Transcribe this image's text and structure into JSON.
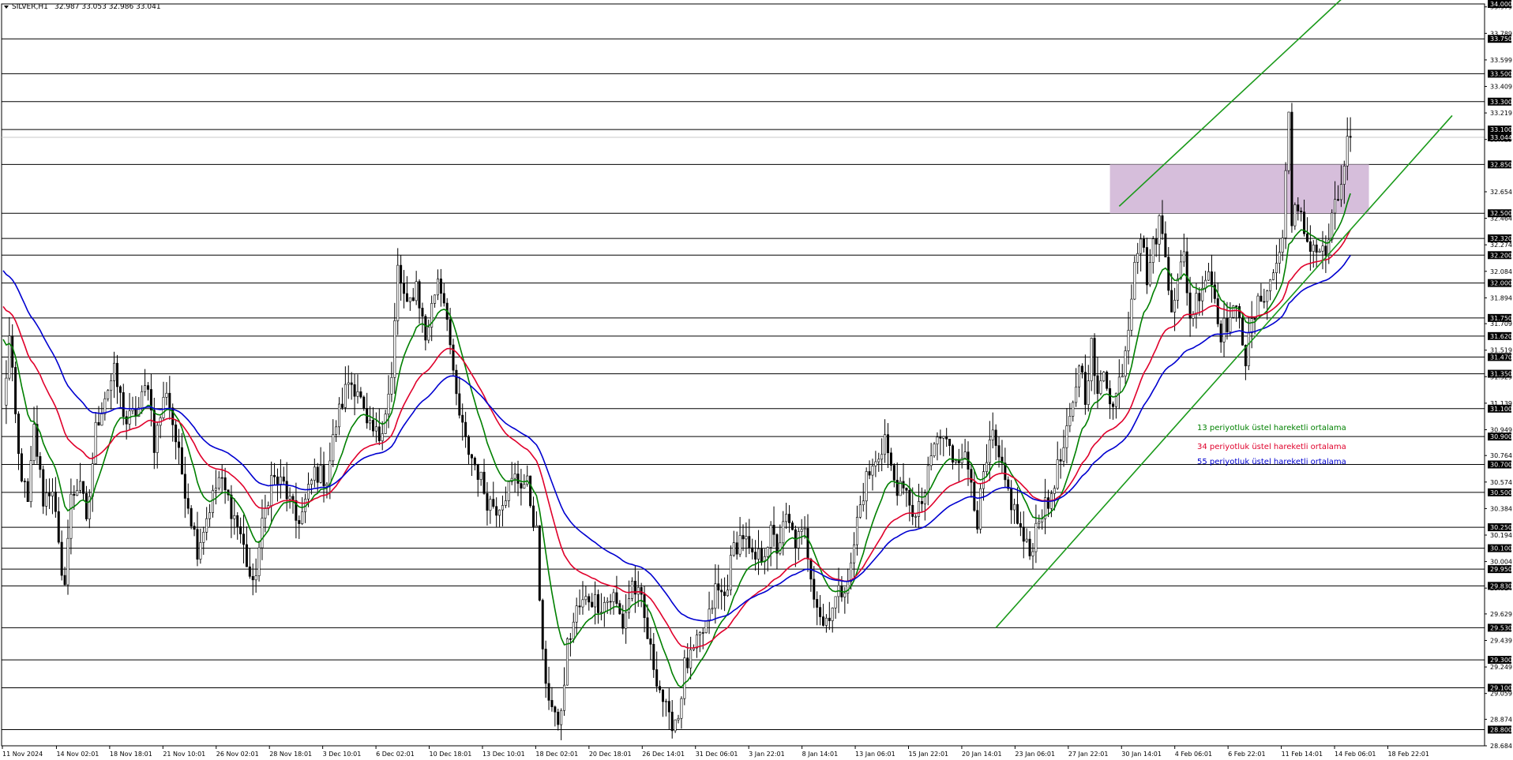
{
  "header": {
    "symbol": "SILVER,H1",
    "ohlc": "32.987 33.053 32.986 33.041"
  },
  "colors": {
    "background": "#ffffff",
    "candle": "#000000",
    "ema13": "#008000",
    "ema34": "#e0002b",
    "ema55": "#0000d0",
    "channel": "#1a9a1a",
    "zone": "#d6bedb",
    "hline": "#000000"
  },
  "chart_data": {
    "type": "candlestick",
    "title": "SILVER,H1",
    "ylim": [
      28.684,
      34.0
    ],
    "grid": false,
    "y_ticks": [
      "33.979",
      "33.789",
      "33.599",
      "33.409",
      "33.219",
      "33.029",
      "32.654",
      "32.464",
      "32.274",
      "32.084",
      "31.894",
      "31.709",
      "31.519",
      "31.329",
      "31.139",
      "30.949",
      "30.764",
      "30.574",
      "30.384",
      "30.194",
      "30.004",
      "29.814",
      "29.629",
      "29.439",
      "29.249",
      "29.059",
      "28.874",
      "28.684"
    ],
    "horizontal_levels": [
      "34.000",
      "33.750",
      "33.500",
      "33.300",
      "33.100",
      "32.850",
      "32.500",
      "32.320",
      "32.200",
      "32.000",
      "31.750",
      "31.620",
      "31.470",
      "31.350",
      "31.100",
      "30.900",
      "30.700",
      "30.500",
      "30.250",
      "30.100",
      "29.950",
      "29.830",
      "29.530",
      "29.300",
      "29.100",
      "28.800"
    ],
    "current_price": "33.044",
    "x_labels": [
      "11 Nov 2024",
      "14 Nov 02:01",
      "18 Nov 18:01",
      "21 Nov 10:01",
      "26 Nov 02:01",
      "28 Nov 18:01",
      "3 Dec 10:01",
      "6 Dec 02:01",
      "10 Dec 18:01",
      "13 Dec 10:01",
      "18 Dec 02:01",
      "20 Dec 18:01",
      "26 Dec 14:01",
      "31 Dec 06:01",
      "3 Jan 22:01",
      "8 Jan 14:01",
      "13 Jan 06:01",
      "15 Jan 22:01",
      "20 Jan 14:01",
      "23 Jan 06:01",
      "27 Jan 22:01",
      "30 Jan 14:01",
      "4 Feb 06:01",
      "6 Feb 22:01",
      "11 Feb 14:01",
      "14 Feb 06:01",
      "18 Feb 22:01"
    ],
    "price_path": [
      [
        0,
        31.1
      ],
      [
        2,
        31.6
      ],
      [
        5,
        30.75
      ],
      [
        8,
        30.4
      ],
      [
        10,
        30.95
      ],
      [
        13,
        30.45
      ],
      [
        16,
        30.55
      ],
      [
        19,
        29.85
      ],
      [
        20,
        29.9
      ],
      [
        22,
        30.45
      ],
      [
        25,
        30.6
      ],
      [
        27,
        30.25
      ],
      [
        30,
        30.95
      ],
      [
        33,
        31.2
      ],
      [
        36,
        31.35
      ],
      [
        40,
        31.0
      ],
      [
        44,
        31.1
      ],
      [
        47,
        31.3
      ],
      [
        49,
        30.85
      ],
      [
        53,
        31.25
      ],
      [
        57,
        30.75
      ],
      [
        63,
        30.1
      ],
      [
        67,
        30.4
      ],
      [
        70,
        30.6
      ],
      [
        73,
        30.45
      ],
      [
        77,
        30.2
      ],
      [
        81,
        29.8
      ],
      [
        84,
        30.25
      ],
      [
        87,
        30.6
      ],
      [
        91,
        30.55
      ],
      [
        95,
        30.3
      ],
      [
        97,
        30.35
      ],
      [
        101,
        30.65
      ],
      [
        105,
        30.6
      ],
      [
        108,
        31.0
      ],
      [
        112,
        31.3
      ],
      [
        115,
        31.25
      ],
      [
        118,
        30.95
      ],
      [
        122,
        30.9
      ],
      [
        126,
        31.3
      ],
      [
        128,
        32.1
      ],
      [
        131,
        31.8
      ],
      [
        134,
        32.0
      ],
      [
        137,
        31.6
      ],
      [
        141,
        32.05
      ],
      [
        144,
        31.8
      ],
      [
        146,
        31.3
      ],
      [
        148,
        31.05
      ],
      [
        150,
        30.85
      ],
      [
        154,
        30.65
      ],
      [
        157,
        30.45
      ],
      [
        160,
        30.4
      ],
      [
        163,
        30.5
      ],
      [
        166,
        30.6
      ],
      [
        170,
        30.55
      ],
      [
        173,
        30.2
      ],
      [
        175,
        29.3
      ],
      [
        177,
        29.05
      ],
      [
        179,
        28.85
      ],
      [
        181,
        28.9
      ],
      [
        183,
        29.4
      ],
      [
        186,
        29.65
      ],
      [
        190,
        29.75
      ],
      [
        194,
        29.7
      ],
      [
        198,
        29.75
      ],
      [
        201,
        29.55
      ],
      [
        204,
        29.85
      ],
      [
        207,
        29.7
      ],
      [
        210,
        29.35
      ],
      [
        213,
        29.1
      ],
      [
        216,
        28.85
      ],
      [
        219,
        28.9
      ],
      [
        221,
        29.25
      ],
      [
        223,
        29.3
      ],
      [
        226,
        29.45
      ],
      [
        229,
        29.6
      ],
      [
        231,
        29.8
      ],
      [
        234,
        29.75
      ],
      [
        237,
        30.1
      ],
      [
        240,
        30.2
      ],
      [
        243,
        30.0
      ],
      [
        246,
        30.05
      ],
      [
        249,
        30.2
      ],
      [
        251,
        30.1
      ],
      [
        254,
        30.3
      ],
      [
        257,
        30.15
      ],
      [
        260,
        30.2
      ],
      [
        263,
        29.8
      ],
      [
        266,
        29.55
      ],
      [
        269,
        29.7
      ],
      [
        272,
        29.8
      ],
      [
        275,
        29.95
      ],
      [
        277,
        30.3
      ],
      [
        280,
        30.6
      ],
      [
        283,
        30.7
      ],
      [
        286,
        30.9
      ],
      [
        288,
        30.65
      ],
      [
        291,
        30.5
      ],
      [
        294,
        30.45
      ],
      [
        296,
        30.3
      ],
      [
        299,
        30.5
      ],
      [
        302,
        30.85
      ],
      [
        305,
        30.9
      ],
      [
        308,
        30.75
      ],
      [
        311,
        30.8
      ],
      [
        314,
        30.6
      ],
      [
        316,
        30.3
      ],
      [
        318,
        30.6
      ],
      [
        321,
        30.9
      ],
      [
        323,
        30.7
      ],
      [
        326,
        30.5
      ],
      [
        329,
        30.3
      ],
      [
        331,
        30.15
      ],
      [
        333,
        30.05
      ],
      [
        336,
        30.35
      ],
      [
        339,
        30.4
      ],
      [
        341,
        30.6
      ],
      [
        344,
        30.8
      ],
      [
        347,
        31.1
      ],
      [
        349,
        31.45
      ],
      [
        351,
        31.2
      ],
      [
        353,
        31.55
      ],
      [
        355,
        31.15
      ],
      [
        357,
        31.4
      ],
      [
        360,
        31.1
      ],
      [
        363,
        31.4
      ],
      [
        365,
        31.7
      ],
      [
        367,
        32.2
      ],
      [
        369,
        32.35
      ],
      [
        371,
        32.05
      ],
      [
        373,
        32.25
      ],
      [
        375,
        32.45
      ],
      [
        377,
        32.2
      ],
      [
        379,
        31.85
      ],
      [
        381,
        32.0
      ],
      [
        383,
        32.2
      ],
      [
        385,
        31.75
      ],
      [
        388,
        31.95
      ],
      [
        391,
        32.1
      ],
      [
        393,
        31.9
      ],
      [
        395,
        31.65
      ],
      [
        398,
        31.75
      ],
      [
        401,
        31.8
      ],
      [
        403,
        31.45
      ],
      [
        405,
        31.7
      ],
      [
        408,
        31.9
      ],
      [
        411,
        32.0
      ],
      [
        413,
        32.15
      ],
      [
        415,
        32.3
      ],
      [
        417,
        33.3
      ],
      [
        418,
        32.4
      ],
      [
        419,
        32.5
      ],
      [
        421,
        32.45
      ],
      [
        423,
        32.3
      ],
      [
        426,
        32.25
      ],
      [
        429,
        32.2
      ],
      [
        431,
        32.45
      ],
      [
        433,
        32.6
      ],
      [
        435,
        32.85
      ],
      [
        436,
        33.0
      ],
      [
        437,
        33.044
      ]
    ],
    "series": [
      {
        "name": "13 periyotluk üstel hareketli ortalama",
        "type": "ema",
        "period": 13
      },
      {
        "name": "34 periyotluk üstel hareketli ortalama",
        "type": "ema",
        "period": 34
      },
      {
        "name": "55 periyotluk üstel hareketli ortalama",
        "type": "ema",
        "period": 55
      }
    ],
    "rectangle_zone": {
      "x_from": 359,
      "x_to": 443,
      "y_from": 32.5,
      "y_to": 32.85
    },
    "trend_lines": [
      {
        "name": "channel-upper",
        "points": [
          [
            362,
            32.55
          ],
          [
            447,
            34.3
          ]
        ]
      },
      {
        "name": "channel-lower",
        "points": [
          [
            322,
            29.53
          ],
          [
            470,
            33.2
          ]
        ]
      }
    ]
  },
  "legend": [
    "13 periyotluk üstel hareketli ortalama",
    "34 periyotluk üstel hareketli ortalama",
    "55 periyotluk üstel hareketli ortalama"
  ]
}
